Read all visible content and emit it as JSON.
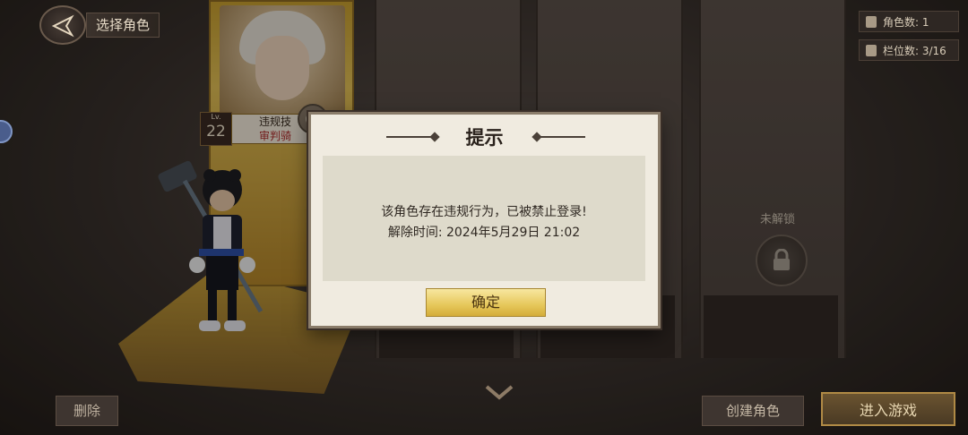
{
  "header": {
    "title": "选择角色"
  },
  "stats": {
    "role_count": "角色数: 1",
    "slot_count": "栏位数: 3/16"
  },
  "character": {
    "level_label": "Lv.",
    "level": "22",
    "name": "违规技",
    "class": "审判骑"
  },
  "slots": {
    "locked_label": "未解锁"
  },
  "buttons": {
    "delete": "删除",
    "create": "创建角色",
    "enter": "进入游戏"
  },
  "modal": {
    "title": "提示",
    "message": "该角色存在违规行为，已被禁止登录!",
    "unban": "解除时间: 2024年5月29日 21:02",
    "confirm": "确定"
  },
  "colors": {
    "gold": "#e3c156",
    "modal_bg": "#f0ebe0",
    "confirm": "#e6c75a"
  }
}
